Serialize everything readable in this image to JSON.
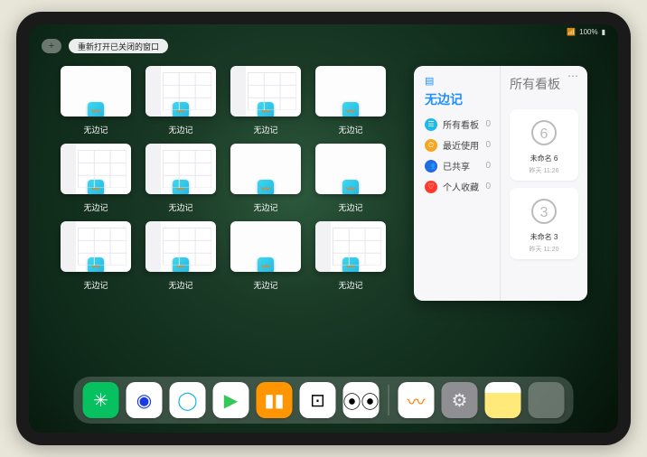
{
  "status": {
    "signal": "•ᴥ",
    "battery": "100%"
  },
  "topbar": {
    "plus": "+",
    "reopen": "重新打开已关闭的窗口"
  },
  "window_label": "无边记",
  "window_count": 12,
  "panel": {
    "left_title": "无边记",
    "right_title": "所有看板",
    "items": [
      {
        "label": "所有看板",
        "count": "0",
        "color": "#1fb8e8",
        "glyph": "☰"
      },
      {
        "label": "最近使用",
        "count": "0",
        "color": "#f5a623",
        "glyph": "⏱"
      },
      {
        "label": "已共享",
        "count": "0",
        "color": "#2366e8",
        "glyph": "👥"
      },
      {
        "label": "个人收藏",
        "count": "0",
        "color": "#ff3b30",
        "glyph": "♡"
      }
    ],
    "boards": [
      {
        "name": "未命名 6",
        "date": "昨天 11:26",
        "sketch": "6"
      },
      {
        "name": "未命名 3",
        "date": "昨天 11:20",
        "sketch": "3"
      }
    ]
  },
  "dock": [
    {
      "name": "wechat",
      "bg": "#07c160",
      "glyph": "✳",
      "fg": "#fff"
    },
    {
      "name": "browser1",
      "bg": "#ffffff",
      "glyph": "◉",
      "fg": "#1a3ae8"
    },
    {
      "name": "browser2",
      "bg": "#ffffff",
      "glyph": "◯",
      "fg": "#1fb8e8"
    },
    {
      "name": "play",
      "bg": "#ffffff",
      "glyph": "▶",
      "fg": "#34c759"
    },
    {
      "name": "books",
      "bg": "#ff9500",
      "glyph": "▮▮",
      "fg": "#fff"
    },
    {
      "name": "dice",
      "bg": "#ffffff",
      "glyph": "⊡",
      "fg": "#000"
    },
    {
      "name": "dots",
      "bg": "#ffffff",
      "glyph": "⦿⦿",
      "fg": "#000"
    }
  ],
  "dock_right": [
    {
      "name": "freeform",
      "bg": "#ffffff",
      "glyph": "〰",
      "fg": "#ff7a00"
    },
    {
      "name": "settings",
      "bg": "#8e8e93",
      "glyph": "⚙",
      "fg": "#eee"
    },
    {
      "name": "notes",
      "bg": "#ffe97a",
      "glyph": "",
      "fg": "#fff"
    }
  ]
}
